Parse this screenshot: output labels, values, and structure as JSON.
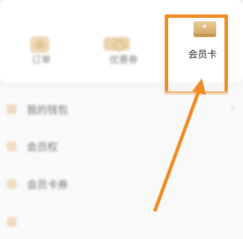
{
  "quick_actions": [
    {
      "label": "订单",
      "icon": "order-icon"
    },
    {
      "label": "优惠券",
      "icon": "coupon-icon"
    },
    {
      "label": "会员卡",
      "icon": "vip-card-icon"
    }
  ],
  "menu": [
    {
      "label": "我的钱包",
      "icon": "wallet-icon"
    },
    {
      "label": "会员权",
      "icon": "member-icon"
    },
    {
      "label": "会员卡券",
      "icon": "ticket-icon"
    }
  ],
  "colors": {
    "highlight": "#f08a22",
    "accent_gold": "#d9b073"
  }
}
